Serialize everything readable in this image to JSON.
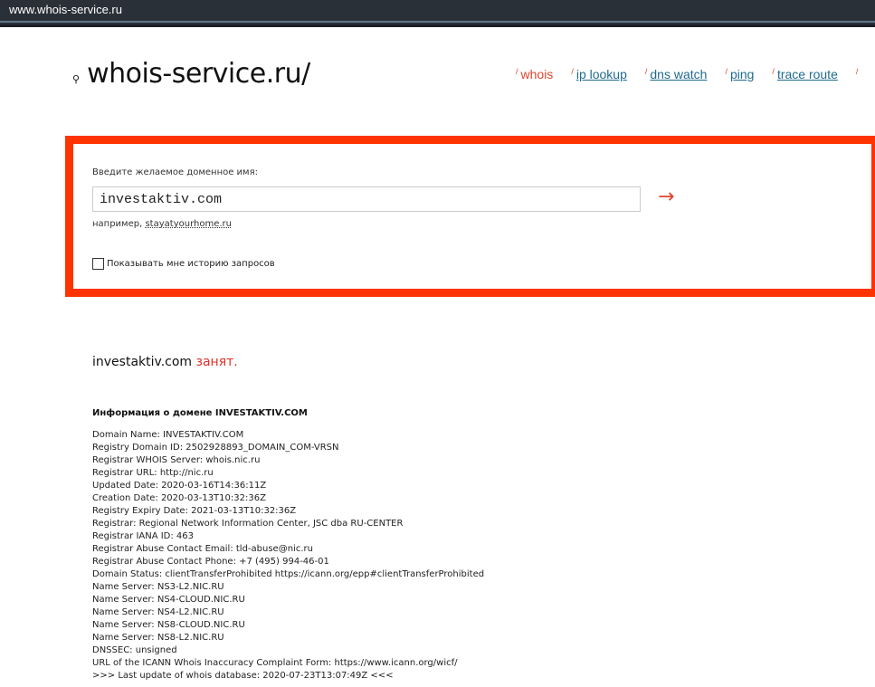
{
  "browser": {
    "url": "www.whois-service.ru"
  },
  "header": {
    "logo": "whois-service.ru/",
    "nav": [
      {
        "label": "whois",
        "active": true
      },
      {
        "label": "ip lookup"
      },
      {
        "label": "dns watch"
      },
      {
        "label": "ping"
      },
      {
        "label": "trace route"
      }
    ]
  },
  "form": {
    "label": "Введите желаемое доменное имя:",
    "value": "investaktiv.com",
    "submit": "→",
    "example_prefix": "например,",
    "example_link": "stayatyourhome.ru",
    "history_label": "Показывать мне историю запросов"
  },
  "result": {
    "domain": "investaktiv.com",
    "status": "занят."
  },
  "info": {
    "title": "Информация о домене INVESTAKTIV.COM",
    "lines": [
      "Domain Name: INVESTAKTIV.COM",
      "Registry Domain ID: 2502928893_DOMAIN_COM-VRSN",
      "Registrar WHOIS Server: whois.nic.ru",
      "Registrar URL: http://nic.ru",
      "Updated Date: 2020-03-16T14:36:11Z",
      "Creation Date: 2020-03-13T10:32:36Z",
      "Registry Expiry Date: 2021-03-13T10:32:36Z",
      "Registrar: Regional Network Information Center, JSC dba RU-CENTER",
      "Registrar IANA ID: 463",
      "Registrar Abuse Contact Email: tld-abuse@nic.ru",
      "Registrar Abuse Contact Phone: +7 (495) 994-46-01",
      "Domain Status: clientTransferProhibited https://icann.org/epp#clientTransferProhibited",
      "Name Server: NS3-L2.NIC.RU",
      "Name Server: NS4-CLOUD.NIC.RU",
      "Name Server: NS4-L2.NIC.RU",
      "Name Server: NS8-CLOUD.NIC.RU",
      "Name Server: NS8-L2.NIC.RU",
      "DNSSEC: unsigned",
      "URL of the ICANN Whois Inaccuracy Complaint Form: https://www.icann.org/wicf/",
      ">>> Last update of whois database: 2020-07-23T13:07:49Z <<<"
    ]
  }
}
